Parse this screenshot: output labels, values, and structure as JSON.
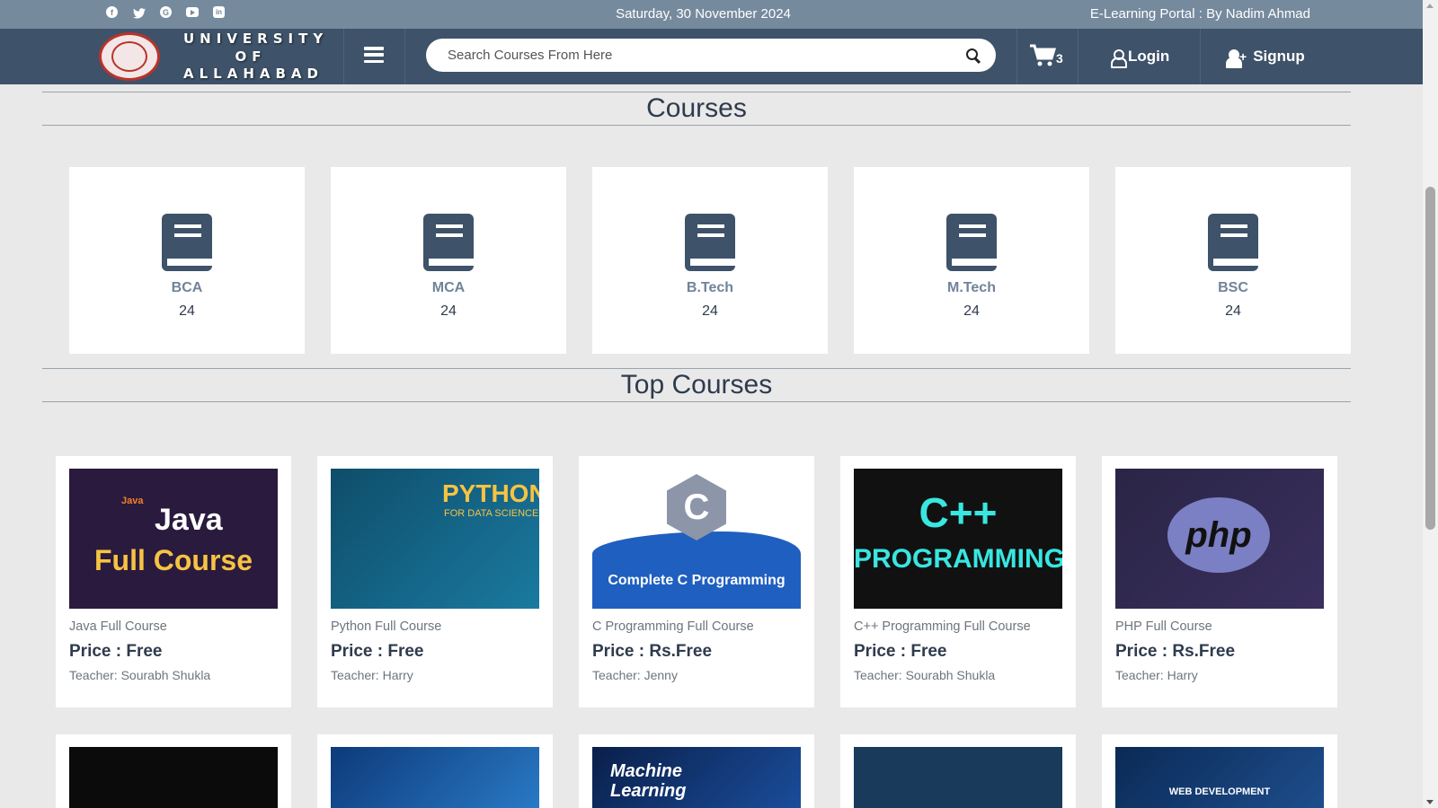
{
  "topbar": {
    "social_icons": [
      "facebook-icon",
      "twitter-icon",
      "google-icon",
      "youtube-icon",
      "linkedin-icon"
    ],
    "date": "Saturday, 30 November 2024",
    "tagline": "E-Learning Portal : By Nadim Ahmad"
  },
  "navbar": {
    "brand_line1": "UNIVERSITY",
    "brand_line2": "OF",
    "brand_line3": "ALLAHABAD",
    "search_placeholder": "Search Courses From Here",
    "cart_count": "3",
    "login_label": "Login",
    "signup_label": "Signup"
  },
  "courses_section": {
    "title": "Courses",
    "categories": [
      {
        "name": "BCA",
        "count": "24"
      },
      {
        "name": "MCA",
        "count": "24"
      },
      {
        "name": "B.Tech",
        "count": "24"
      },
      {
        "name": "M.Tech",
        "count": "24"
      },
      {
        "name": "BSC",
        "count": "24"
      }
    ]
  },
  "top_courses_section": {
    "title": "Top Courses",
    "courses": [
      {
        "name": "Java Full Course",
        "price": "Price : Free",
        "teacher": "Teacher: Sourabh Shukla",
        "thumb_java": "Java",
        "thumb_java_sub": "Full Course",
        "thumb_logo": "Java"
      },
      {
        "name": "Python Full Course",
        "price": "Price : Free",
        "teacher": "Teacher: Harry",
        "thumb_title": "PYTHON",
        "thumb_sub": "FOR DATA SCIENCE"
      },
      {
        "name": "C Programming Full Course",
        "price": "Price : Rs.Free",
        "teacher": "Teacher: Jenny",
        "thumb_letter": "C",
        "thumb_text": "Complete C Programming"
      },
      {
        "name": "C++ Programming Full Course",
        "price": "Price : Free",
        "teacher": "Teacher: Sourabh Shukla",
        "thumb_line1": "C++",
        "thumb_line2": "PROGRAMMING"
      },
      {
        "name": "PHP Full Course",
        "price": "Price : Rs.Free",
        "teacher": "Teacher: Harry",
        "thumb_logo": "php"
      }
    ],
    "second_row_thumbs": {
      "ml_line1": "Machine",
      "ml_line2": "Learning",
      "web_text": "WEB DEVELOPMENT"
    }
  },
  "colors": {
    "topbar": "#768a9e",
    "navbar": "#3e5269",
    "page_bg": "#e9e9e9"
  }
}
